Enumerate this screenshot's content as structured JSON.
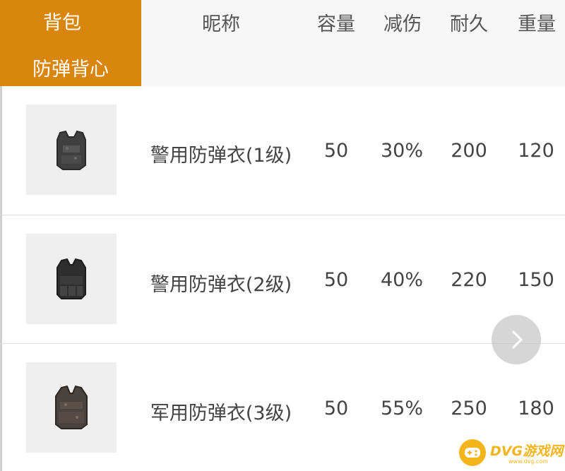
{
  "tabs": [
    {
      "label": "背包",
      "active": false
    },
    {
      "label": "防弹背心",
      "active": true
    }
  ],
  "columns": [
    "昵称",
    "容量",
    "减伤",
    "耐久",
    "重量"
  ],
  "items": [
    {
      "icon": "vest-level-1-icon",
      "name": "警用防弹衣(1级)",
      "capacity": "50",
      "reduction": "30%",
      "durability": "200",
      "weight": "120"
    },
    {
      "icon": "vest-level-2-icon",
      "name": "警用防弹衣(2级)",
      "capacity": "50",
      "reduction": "40%",
      "durability": "220",
      "weight": "150"
    },
    {
      "icon": "vest-level-3-icon",
      "name": "军用防弹衣(3级)",
      "capacity": "50",
      "reduction": "55%",
      "durability": "250",
      "weight": "180"
    }
  ],
  "watermark": {
    "text": "DVG游戏网",
    "sub": "www.dvg.com"
  },
  "colors": {
    "tab_active": "#d9860e",
    "header_bg": "#f7f7f7",
    "watermark": "#f3b51b"
  }
}
